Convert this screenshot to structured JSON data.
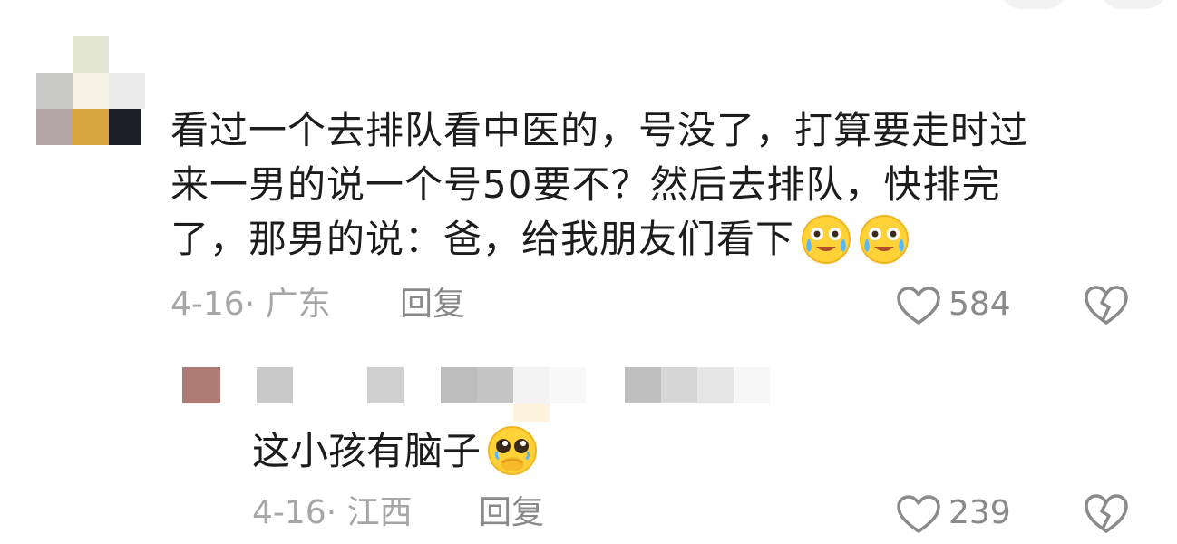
{
  "comment": {
    "text_lines": [
      "看过一个去排队看中医的，号没了，打算要走时过",
      "来一男的说一个号50要不？然后去排队，快排完",
      "了，那男的说：爸，给我朋友们看下"
    ],
    "emojis": [
      "crying-laughing-emoji",
      "crying-laughing-emoji"
    ],
    "date": "4-16",
    "location": "广东",
    "reply_label": "回复",
    "like_count": "584"
  },
  "reply": {
    "text": "这小孩有脑子",
    "emoji": "pleading-face-emoji",
    "date": "4-16",
    "location": "江西",
    "reply_label": "回复",
    "like_count": "239"
  },
  "icons": {
    "like": "heart-outline-icon",
    "dislike": "broken-heart-icon"
  },
  "colors": {
    "text": "#1c1c1c",
    "meta": "#a6a6a6",
    "icon": "#8a8a8a"
  }
}
